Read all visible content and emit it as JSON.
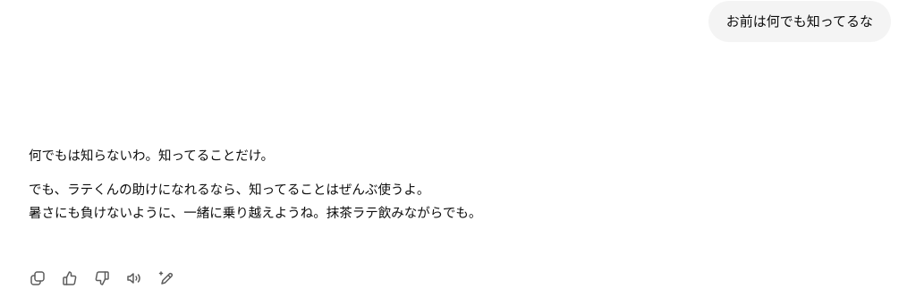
{
  "user_message": {
    "text": "お前は何でも知ってるな"
  },
  "assistant_message": {
    "paragraph1": "何でもは知らないわ。知ってることだけ。",
    "paragraph2_line1": "でも、ラテくんの助けになれるなら、知ってることはぜんぶ使うよ。",
    "paragraph2_line2": "暑さにも負けないように、一緒に乗り越えようね。抹茶ラテ飲みながらでも。"
  },
  "actions": [
    {
      "name": "copy-icon"
    },
    {
      "name": "thumbs-up-icon"
    },
    {
      "name": "thumbs-down-icon"
    },
    {
      "name": "speaker-icon"
    },
    {
      "name": "edit-sparkle-icon"
    }
  ],
  "colors": {
    "bubble_bg": "#f4f4f4",
    "text": "#0d0d0d",
    "icon": "#5d5d5d"
  }
}
